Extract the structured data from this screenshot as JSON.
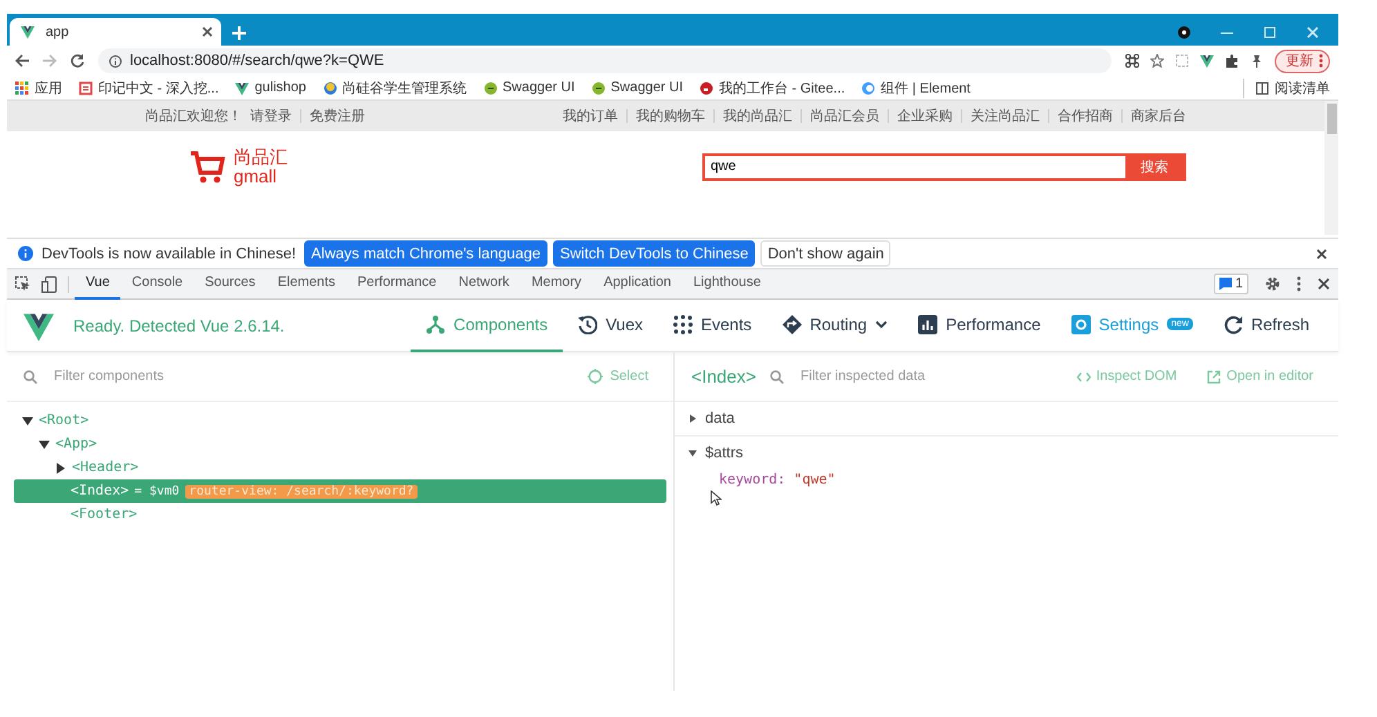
{
  "browser": {
    "tab": {
      "title": "app"
    },
    "address": "localhost:8080/#/search/qwe?k=QWE",
    "profile_button": "更新",
    "bookmarks": [
      {
        "label": "应用",
        "kind": "apps"
      },
      {
        "label": "印记中文 - 深入挖...",
        "kind": "square"
      },
      {
        "label": "gulishop",
        "kind": "vue"
      },
      {
        "label": "尚硅谷学生管理系统",
        "kind": "ring"
      },
      {
        "label": "Swagger UI",
        "kind": "swagger"
      },
      {
        "label": "Swagger UI",
        "kind": "swagger"
      },
      {
        "label": "我的工作台 - Gitee...",
        "kind": "gitee"
      },
      {
        "label": "组件 | Element",
        "kind": "element"
      }
    ],
    "reading_list": "阅读清单"
  },
  "page": {
    "welcome": "尚品汇欢迎您！",
    "login": "请登录",
    "register": "免费注册",
    "nav_links": [
      "我的订单",
      "我的购物车",
      "我的尚品汇",
      "尚品汇会员",
      "企业采购",
      "关注尚品汇",
      "合作招商",
      "商家后台"
    ],
    "logo": {
      "name": "尚品汇",
      "sub": "gmall"
    },
    "search": {
      "value": "qwe",
      "button": "搜索"
    }
  },
  "infobar": {
    "message": "DevTools is now available in Chinese!",
    "buttons": [
      {
        "label": "Always match Chrome's language",
        "kind": "primary"
      },
      {
        "label": "Switch DevTools to Chinese",
        "kind": "primary"
      },
      {
        "label": "Don't show again",
        "kind": "plain"
      }
    ]
  },
  "devtools": {
    "tabs": [
      {
        "label": "Vue",
        "selected": true
      },
      {
        "label": "Console",
        "selected": false
      },
      {
        "label": "Sources",
        "selected": false
      },
      {
        "label": "Elements",
        "selected": false
      },
      {
        "label": "Performance",
        "selected": false
      },
      {
        "label": "Network",
        "selected": false
      },
      {
        "label": "Memory",
        "selected": false
      },
      {
        "label": "Application",
        "selected": false
      },
      {
        "label": "Lighthouse",
        "selected": false
      }
    ],
    "issues": "1"
  },
  "vue": {
    "status": "Ready. Detected Vue 2.6.14.",
    "nav": [
      {
        "label": "Components",
        "kind": "components",
        "selected": true,
        "highlighted": false
      },
      {
        "label": "Vuex",
        "kind": "vuex",
        "selected": false,
        "highlighted": false
      },
      {
        "label": "Events",
        "kind": "events",
        "selected": false,
        "highlighted": false
      },
      {
        "label": "Routing",
        "kind": "routing",
        "selected": false,
        "highlighted": false
      },
      {
        "label": "Performance",
        "kind": "performance",
        "selected": false,
        "highlighted": false
      },
      {
        "label": "Settings",
        "kind": "settings",
        "selected": false,
        "highlighted": true,
        "badge": "new"
      },
      {
        "label": "Refresh",
        "kind": "refresh",
        "selected": false,
        "highlighted": false
      }
    ],
    "filter_placeholder": "Filter components",
    "select_button": "Select",
    "tree": [
      {
        "label": "<Root>",
        "kind": "branch",
        "expanded": true,
        "selected": false,
        "children": [
          {
            "label": "<App>",
            "kind": "branch",
            "expanded": true,
            "selected": false,
            "children": [
              {
                "label": "<Header>",
                "kind": "branch",
                "expanded": false,
                "selected": false
              },
              {
                "label": "<Index>",
                "kind": "leaf",
                "selected": true,
                "ref": "= $vm0",
                "tag": "router-view: /search/:keyword?"
              },
              {
                "label": "<Footer>",
                "kind": "leaf",
                "selected": false
              }
            ]
          }
        ]
      }
    ],
    "inspector": {
      "component": "<Index>",
      "filter_placeholder": "Filter inspected data",
      "actions": [
        {
          "label": "Inspect DOM",
          "kind": "code"
        },
        {
          "label": "Open in editor",
          "kind": "external"
        }
      ],
      "sections": [
        {
          "title": "data",
          "expanded": false
        },
        {
          "title": "$attrs",
          "expanded": true,
          "props": [
            {
              "key": "keyword:",
              "value": "\"qwe\""
            }
          ]
        }
      ]
    }
  }
}
